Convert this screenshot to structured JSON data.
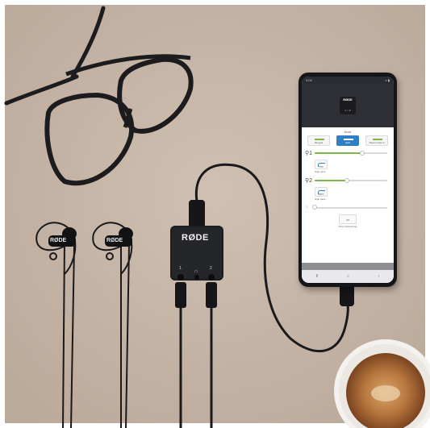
{
  "phone_app": {
    "status_time": "9:04",
    "status_icons": "◖ ▮",
    "device_badge": "RØDE",
    "device_jacks": "1 ∩ 2",
    "mode_label": "Mode",
    "modes": [
      {
        "label": "Merged",
        "active": false
      },
      {
        "label": "Split",
        "active": true
      },
      {
        "label": "Stereo Input 2",
        "active": false
      }
    ],
    "channel_1": {
      "label": "⚲1",
      "level": 0.66,
      "filter_value": "75Hz",
      "filter_caption": "High pass"
    },
    "channel_2": {
      "label": "⚲2",
      "level": 0.44,
      "filter_value": "150Hz",
      "filter_caption": "High pass"
    },
    "headphone": {
      "label": "∩",
      "level": 0.0
    },
    "direct_monitor": {
      "value": "Off",
      "caption": "Direct Monitoring"
    },
    "nav": {
      "back": "⦀",
      "home": "○",
      "recent": "‹"
    },
    "accent_color": "#2f7fc4",
    "level_color": "#7ab648"
  },
  "interface": {
    "brand": "RØDE",
    "port_1": "1",
    "port_2": "2",
    "headphone_mark": "∩"
  },
  "lav_mics": {
    "brand": "RØDE"
  }
}
